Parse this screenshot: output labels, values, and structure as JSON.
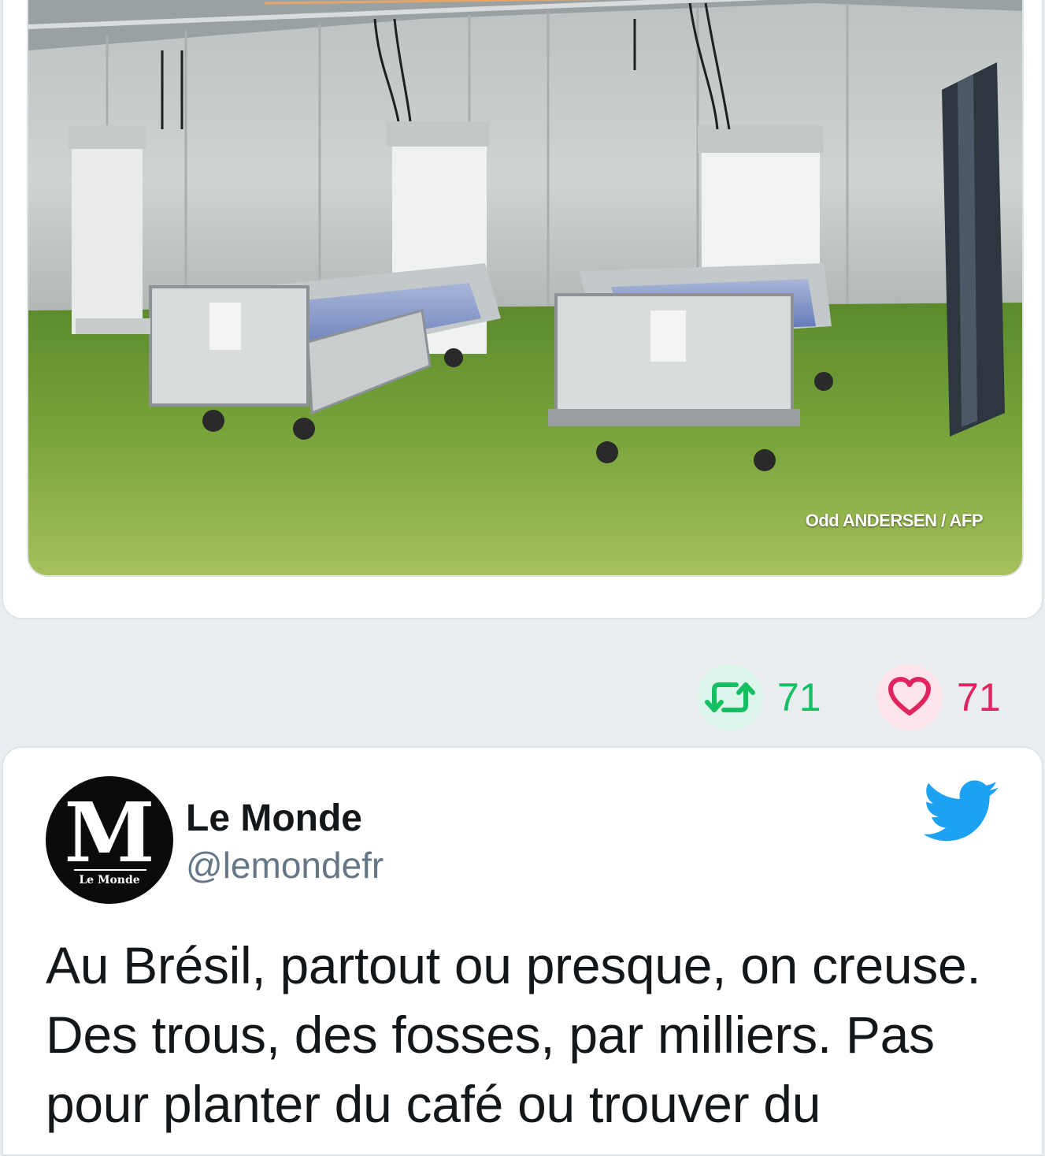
{
  "embedded_tweet": {
    "media": {
      "alt": "",
      "credit": "Odd ANDERSEN / AFP"
    },
    "stats": {
      "retweets": "71",
      "likes": "71"
    },
    "colors": {
      "retweet": "#17bf63",
      "like": "#e0245e",
      "twitter_blue": "#1da1f2"
    }
  },
  "next_tweet": {
    "author": {
      "name": "Le Monde",
      "handle": "@lemondefr",
      "avatar_icon": "le-monde-logo"
    },
    "brand_icon": "twitter-bird-icon",
    "text": "Au Brésil, partout ou presque, on creuse. Des trous, des fosses, par milliers. Pas pour planter du café ou trouver du"
  }
}
